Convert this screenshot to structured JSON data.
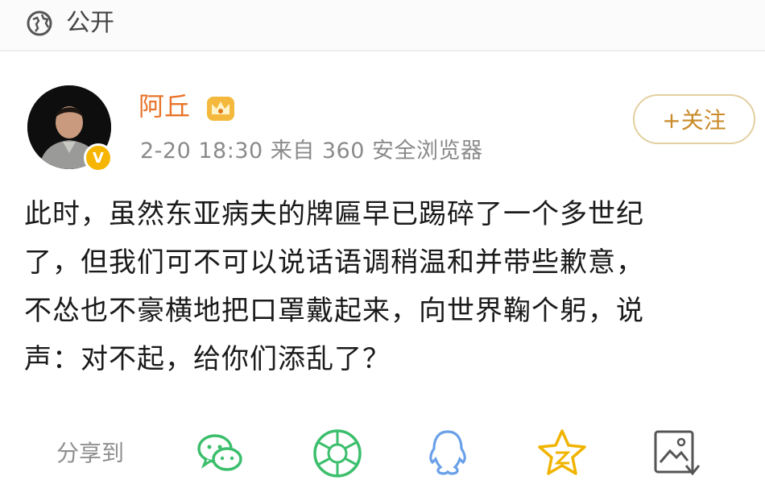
{
  "header": {
    "visibility_icon": "globe-icon",
    "visibility_label": "公开"
  },
  "post": {
    "author": {
      "name": "阿丘",
      "verified_badge": "V",
      "crown_icon": "crown-badge-icon"
    },
    "meta": "2-20 18:30  来自 360 安全浏览器",
    "follow_label": "+关注",
    "text": "此时，虽然东亚病夫的牌匾早已踢碎了一个多世纪\n了，但我们可不可以说话语调稍温和并带些歉意，\n不怂也不豪横地把口罩戴起来，向世界鞠个躬，说\n声：对不起，给你们添乱了？"
  },
  "share": {
    "label": "分享到",
    "targets": [
      {
        "icon": "wechat-icon"
      },
      {
        "icon": "moments-icon"
      },
      {
        "icon": "qq-icon"
      },
      {
        "icon": "qzone-icon"
      },
      {
        "icon": "save-image-icon"
      }
    ]
  },
  "colors": {
    "username": "#e8742a",
    "follow_border": "#e3cfa0",
    "share_green": "#3cbf6d",
    "qq_blue": "#6aa0e8",
    "qzone_gold": "#f0b400"
  }
}
